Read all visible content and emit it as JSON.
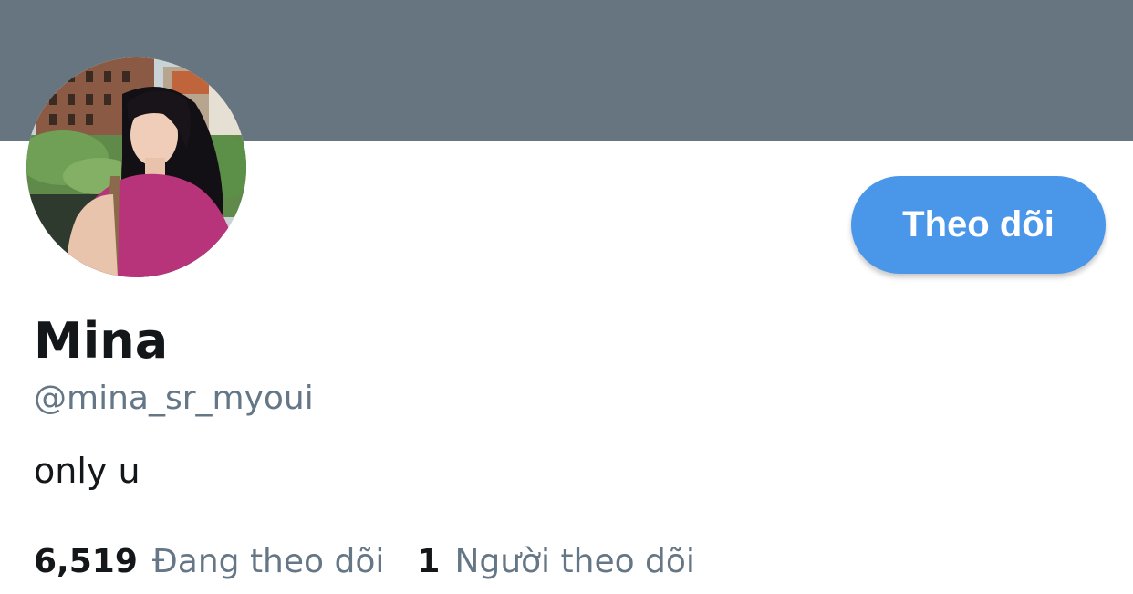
{
  "profile": {
    "name": "Mina",
    "handle": "@mina_sr_myoui",
    "bio": "only u",
    "follow_label": "Theo dõi"
  },
  "stats": {
    "following_count": "6,519",
    "following_label": "Đang theo dõi",
    "followers_count": "1",
    "followers_label": "Người theo dõi"
  },
  "colors": {
    "banner": "#66757f",
    "accent": "#4a96e8",
    "text_primary": "#14171a",
    "text_secondary": "#657786"
  }
}
